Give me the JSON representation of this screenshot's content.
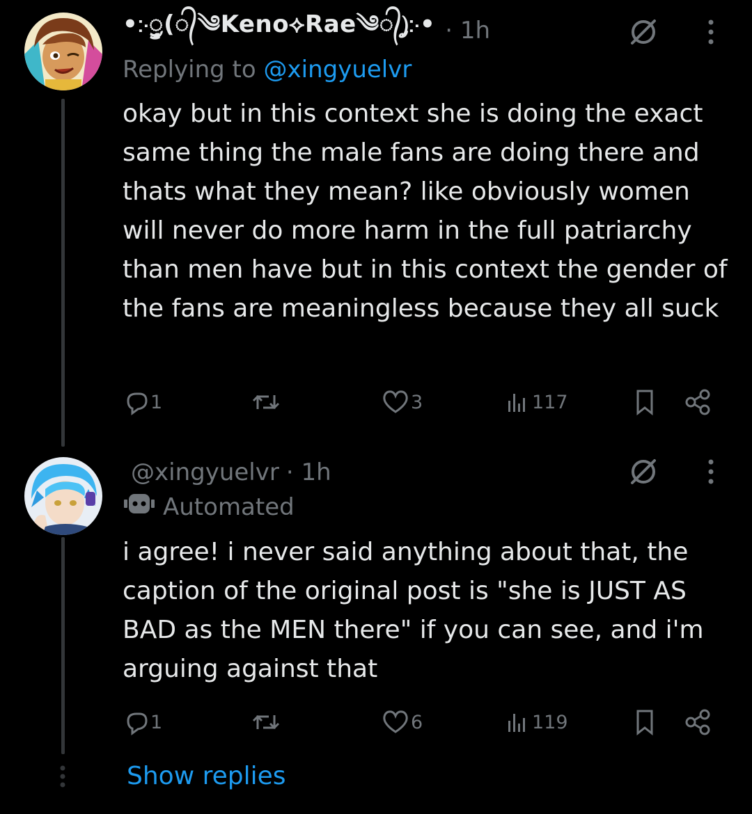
{
  "colors": {
    "background": "#000000",
    "text": "#e7e9ea",
    "muted": "#71767b",
    "link": "#1d9bf0",
    "thread_line": "#333639"
  },
  "tweet1": {
    "display_name": "•჻ॗᤢ(᭄༄Keno⟡Rae༄᭄)ᤢ჻•",
    "time": "· 1h",
    "replying_prefix": "Replying to",
    "replying_to": "@xingyuelvr",
    "text": "okay but in this context she is doing the exact same thing the male fans are doing there and thats what they mean? like obviously women will never do more harm in the full patriarchy than men have but in this context the gender of the fans are meaningless because they all suck",
    "reply_count": "1",
    "retweet_count": "",
    "like_count": "3",
    "view_count": "117",
    "icons": [
      "grok-icon",
      "more-icon",
      "reply-icon",
      "retweet-icon",
      "like-icon",
      "views-icon",
      "bookmark-icon",
      "share-icon"
    ]
  },
  "tweet2": {
    "handle": "@xingyuelvr",
    "time": "· 1h",
    "automated_label": "Automated",
    "text": "i agree! i never said anything about that, the caption of the original post is \"she is JUST AS BAD as the MEN there\" if you can see, and i'm arguing against that",
    "reply_count": "1",
    "retweet_count": "",
    "like_count": "6",
    "view_count": "119",
    "icons": [
      "robot-icon",
      "grok-icon",
      "more-icon",
      "reply-icon",
      "retweet-icon",
      "like-icon",
      "views-icon",
      "bookmark-icon",
      "share-icon"
    ]
  },
  "show_replies_label": "Show replies"
}
